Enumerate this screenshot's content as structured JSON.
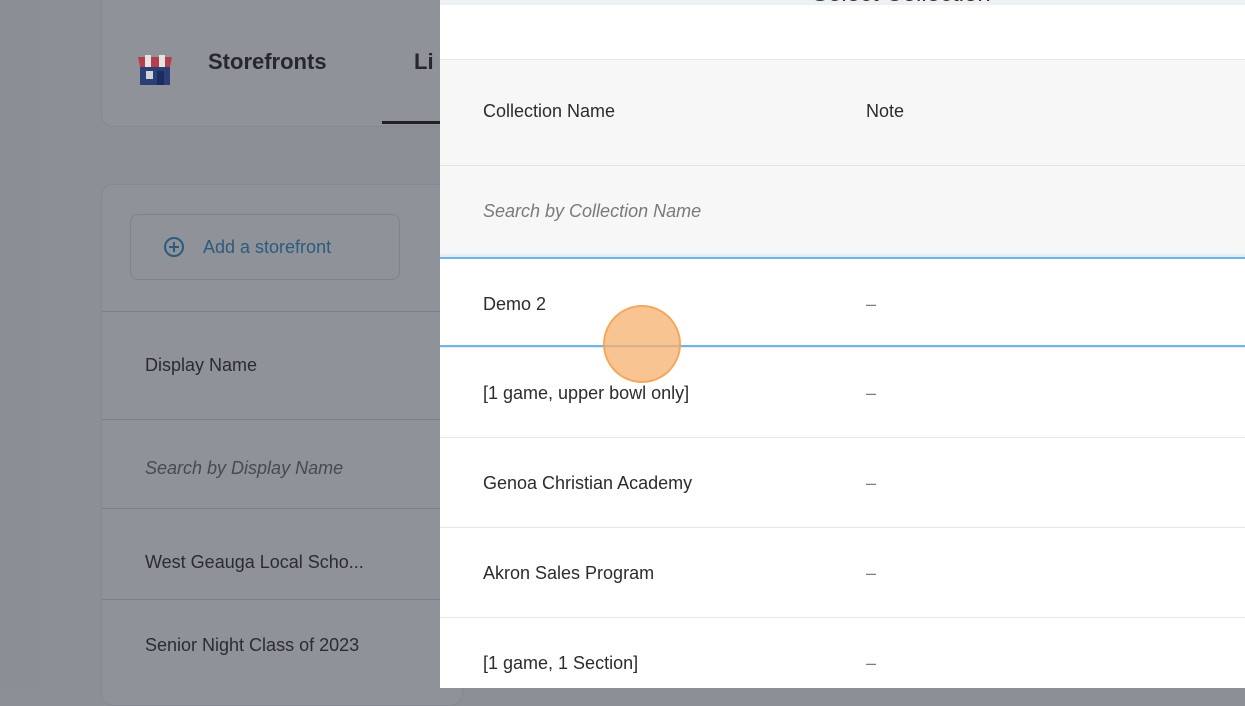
{
  "background": {
    "nav": {
      "title": "Storefronts",
      "tab_fragment": "Li"
    },
    "add_button": {
      "label": "Add a storefront"
    },
    "table": {
      "column": "Display Name",
      "search_placeholder": "Search by Display Name",
      "rows": [
        "West Geauga Local Scho...",
        "Senior Night Class of 2023"
      ]
    }
  },
  "panel": {
    "title": "Select Collection",
    "columns": {
      "name": "Collection Name",
      "note": "Note"
    },
    "search_placeholder": "Search by Collection Name",
    "rows": [
      {
        "name": "Demo 2",
        "note": "–"
      },
      {
        "name": "[1 game, upper bowl only]",
        "note": "–"
      },
      {
        "name": "Genoa Christian Academy",
        "note": "–"
      },
      {
        "name": "Akron Sales Program",
        "note": "–"
      },
      {
        "name": "[1 game, 1 Section]",
        "note": "–"
      }
    ]
  },
  "colors": {
    "accent": "#6fb6e4",
    "link": "#2d5b7d",
    "overlay": "#8c8f95",
    "cursor": "#f6b06c"
  }
}
